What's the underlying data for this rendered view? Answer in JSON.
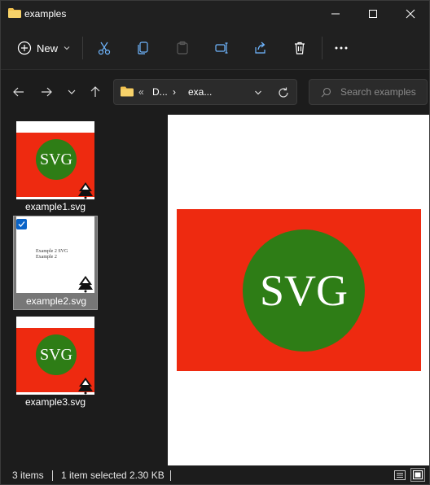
{
  "window": {
    "title": "examples"
  },
  "toolbar": {
    "new_label": "New"
  },
  "address": {
    "overflow": "«",
    "segments": [
      "D...",
      "exa..."
    ]
  },
  "search": {
    "placeholder": "Search examples"
  },
  "files": [
    {
      "name": "example1.svg",
      "thumb_text": "SVG",
      "selected": false
    },
    {
      "name": "example2.svg",
      "thumb_lines": [
        "Example 2 SVG",
        "Example 2"
      ],
      "selected": true
    },
    {
      "name": "example3.svg",
      "thumb_text": "SVG",
      "selected": false
    }
  ],
  "preview": {
    "text": "SVG"
  },
  "status": {
    "count": "3 items",
    "selection": "1 item selected",
    "size": "2.30 KB"
  },
  "colors": {
    "flag_red": "#ee2a10",
    "circle_green": "#2e7d16",
    "accent_blue": "#0a64c8",
    "folder_yellow": "#f2c14e"
  }
}
